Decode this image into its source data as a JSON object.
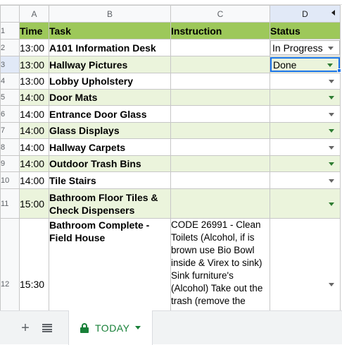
{
  "columns": [
    "A",
    "B",
    "C",
    "D"
  ],
  "header": {
    "row_num": "1",
    "time": "Time",
    "task": "Task",
    "instruction": "Instruction",
    "status": "Status"
  },
  "rows": [
    {
      "num": "2",
      "time": "13:00",
      "task": "A101 Information Desk",
      "instruction": "",
      "status": "In Progress"
    },
    {
      "num": "3",
      "time": "13:00",
      "task": "Hallway Pictures",
      "instruction": "",
      "status": "Done"
    },
    {
      "num": "4",
      "time": "13:00",
      "task": "Lobby Upholstery",
      "instruction": "",
      "status": ""
    },
    {
      "num": "5",
      "time": "14:00",
      "task": "Door Mats",
      "instruction": "",
      "status": ""
    },
    {
      "num": "6",
      "time": "14:00",
      "task": "Entrance Door Glass",
      "instruction": "",
      "status": ""
    },
    {
      "num": "7",
      "time": "14:00",
      "task": "Glass Displays",
      "instruction": "",
      "status": ""
    },
    {
      "num": "8",
      "time": "14:00",
      "task": "Hallway Carpets",
      "instruction": "",
      "status": ""
    },
    {
      "num": "9",
      "time": "14:00",
      "task": "Outdoor Trash Bins",
      "instruction": "",
      "status": ""
    },
    {
      "num": "10",
      "time": "14:00",
      "task": "Tile Stairs",
      "instruction": "",
      "status": ""
    },
    {
      "num": "11",
      "time": "15:00",
      "task": "Bathroom Floor Tiles & Check Dispensers",
      "instruction": "",
      "status": ""
    },
    {
      "num": "12",
      "time": "15:30",
      "task": "Bathroom Complete - Field House",
      "instruction": "CODE 26991 - Clean Toilets (Alcohol, if is brown use Bio Bowl inside & Virex to sink) Sink furniture's (Alcohol) Take out the trash (remove the",
      "status": ""
    }
  ],
  "tabbar": {
    "add_icon": "plus-icon",
    "list_icon": "list-icon",
    "sheet_tab": "TODAY"
  },
  "colors": {
    "header_fill": "#9dc85a",
    "alt_row_fill": "#ebf4dc",
    "selection": "#1a73e8",
    "tab_green": "#188038"
  }
}
